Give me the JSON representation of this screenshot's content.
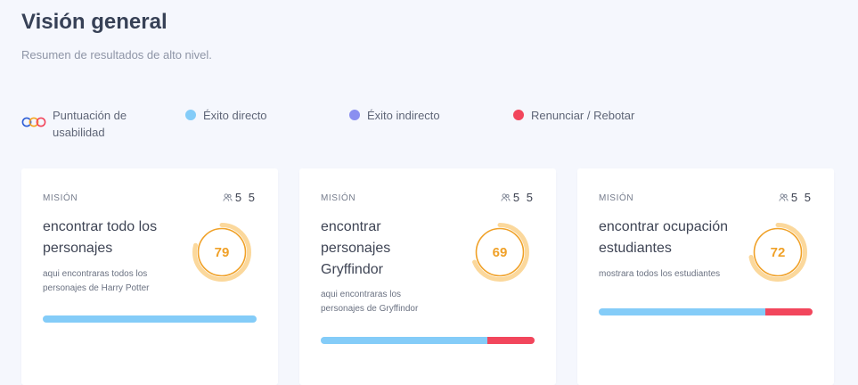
{
  "header": {
    "title": "Visión general",
    "subtitle": "Resumen de resultados de alto nivel."
  },
  "legend": {
    "usability": "Puntuación de usabilidad",
    "direct": "Éxito directo",
    "indirect": "Éxito indirecto",
    "bounce": "Renunciar / Rebotar"
  },
  "colors": {
    "direct": "#84ccf8",
    "indirect": "#8a8ff0",
    "bounce": "#f2465c",
    "score": "#f0a128",
    "score_track": "#fbd89c",
    "usability_rings": [
      "#2f5fd6",
      "#f5a623",
      "#f2465c"
    ]
  },
  "icons": {
    "usability": "three-rings-icon",
    "participants": "users-icon"
  },
  "cards": [
    {
      "kicker": "MISIÓN",
      "participants": "5 5",
      "title": "encontrar todo los personajes",
      "description": "aqui encontraras todos los personajes de Harry Potter",
      "score": "79",
      "score_pct": 79,
      "breakdown": {
        "direct": 100,
        "indirect": 0,
        "bounce": 0
      }
    },
    {
      "kicker": "MISIÓN",
      "participants": "5 5",
      "title": "encontrar personajes Gryffindor",
      "description": "aqui encontraras los personajes de Gryffindor",
      "score": "69",
      "score_pct": 69,
      "breakdown": {
        "direct": 78,
        "indirect": 0,
        "bounce": 22
      }
    },
    {
      "kicker": "MISIÓN",
      "participants": "5 5",
      "title": "encontrar ocupación estudiantes",
      "description": "mostrara todos los estudiantes",
      "score": "72",
      "score_pct": 72,
      "breakdown": {
        "direct": 78,
        "indirect": 0,
        "bounce": 22
      }
    }
  ]
}
